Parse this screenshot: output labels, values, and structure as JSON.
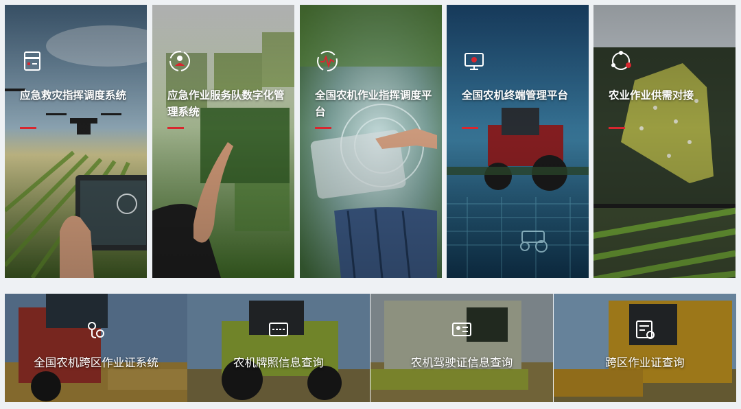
{
  "colors": {
    "accent": "#d8272f",
    "page_bg": "#eef1f4"
  },
  "feature_cards": [
    {
      "title": "应急救灾指挥调度系统",
      "icon": "document-icon"
    },
    {
      "title": "应急作业服务队数字化管理系统",
      "icon": "team-target-icon"
    },
    {
      "title": "全国农机作业指挥调度平台",
      "icon": "dispatch-signal-icon"
    },
    {
      "title": "全国农机终端管理平台",
      "icon": "monitor-terminal-icon"
    },
    {
      "title": "农业作业供需对接",
      "icon": "network-nodes-icon"
    }
  ],
  "query_tiles": [
    {
      "label": "全国农机跨区作业证系统",
      "icon": "location-route-icon"
    },
    {
      "label": "农机牌照信息查询",
      "icon": "license-plate-icon"
    },
    {
      "label": "农机驾驶证信息查询",
      "icon": "id-card-icon"
    },
    {
      "label": "跨区作业证查询",
      "icon": "certificate-icon"
    }
  ]
}
